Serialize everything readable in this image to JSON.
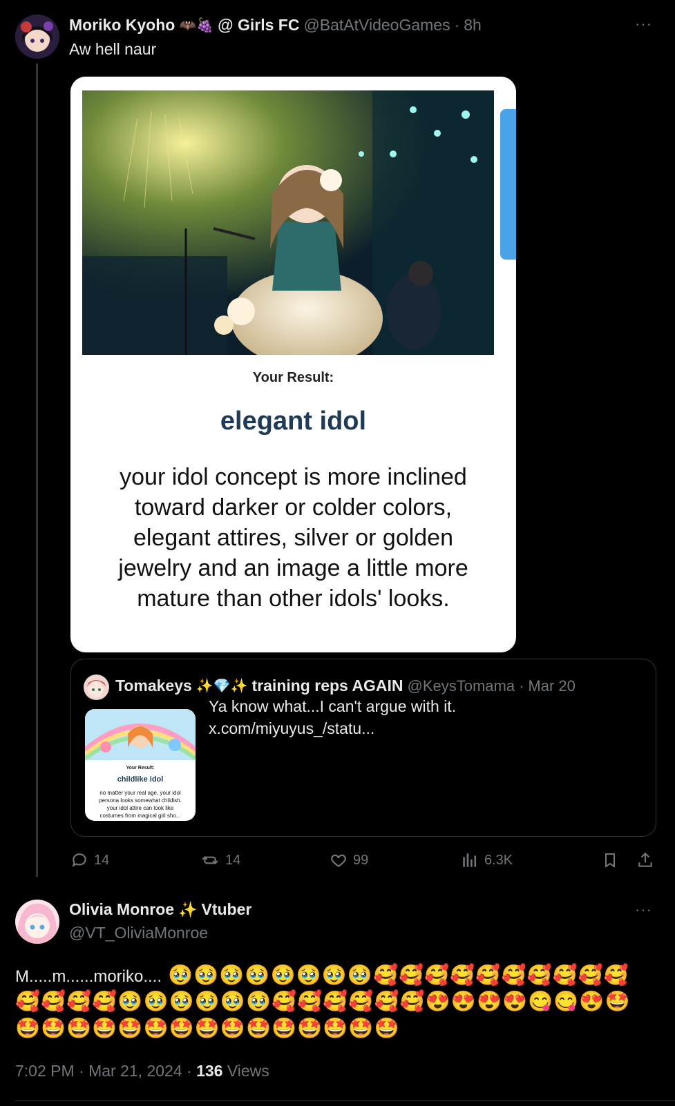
{
  "tweet": {
    "display_name": "Moriko Kyoho",
    "name_emoji": "🦇🍇",
    "name_suffix": "@ Girls FC",
    "handle": "@BatAtVideoGames",
    "separator": "·",
    "time": "8h",
    "text": "Aw hell naur",
    "image_card": {
      "result_heading": "Your Result:",
      "result_title": "elegant idol",
      "result_description_lines": [
        "your idol concept is more inclined",
        "toward darker or colder colors,",
        "elegant attires, silver or golden",
        "jewelry and an image a little more",
        "mature than other idols' looks."
      ]
    },
    "quoted": {
      "display_name": "Tomakeys",
      "name_emoji": "✨💎✨",
      "name_suffix": "training reps AGAIN",
      "handle": "@KeysTomama",
      "separator": "·",
      "date": "Mar 20",
      "text_line1": "Ya know what...I can't argue with it.",
      "text_line2": "x.com/miyuyus_/statu...",
      "thumbnail": {
        "result_heading": "Your Result:",
        "result_title": "childlike idol",
        "description_lines": [
          "no matter your real age, your idol",
          "persona looks somewhat childish.",
          "your idol attire can look like",
          "costumes from magical girl sho..."
        ]
      }
    },
    "actions": {
      "replies": "14",
      "reposts": "14",
      "likes": "99",
      "views": "6.3K"
    },
    "more_label": "···"
  },
  "reply": {
    "display_name": "Olivia Monroe",
    "name_emoji": "✨",
    "name_suffix": "Vtuber",
    "handle": "@VT_OliviaMonroe",
    "more_label": "···",
    "text_prefix": "M.....m......moriko....",
    "emoji_line1": "🥹🥹🥹🥹🥹🥹🥹🥹🥰🥰🥰🥰🥰🥰🥰🥰🥰🥰",
    "emoji_line2": "🥰🥰🥰🥰🥹🥹🥹🥹🥹🥹🥰🥰🥰🥰🥰🥰😍😍😍😍😋😋😍🤩",
    "emoji_line3": "🤩🤩🤩🤩🤩🤩🤩🤩🤩🤩🤩🤩🤩🤩🤩",
    "timestamp": "7:02 PM · Mar 21, 2024 ·",
    "views_count": "136",
    "views_label": "Views"
  },
  "colors": {
    "background": "#000000",
    "text": "#e7e9ea",
    "muted": "#71767b",
    "border": "#2f3336",
    "result_title": "#1f3a57",
    "accent_blue": "#1d9bf0"
  }
}
